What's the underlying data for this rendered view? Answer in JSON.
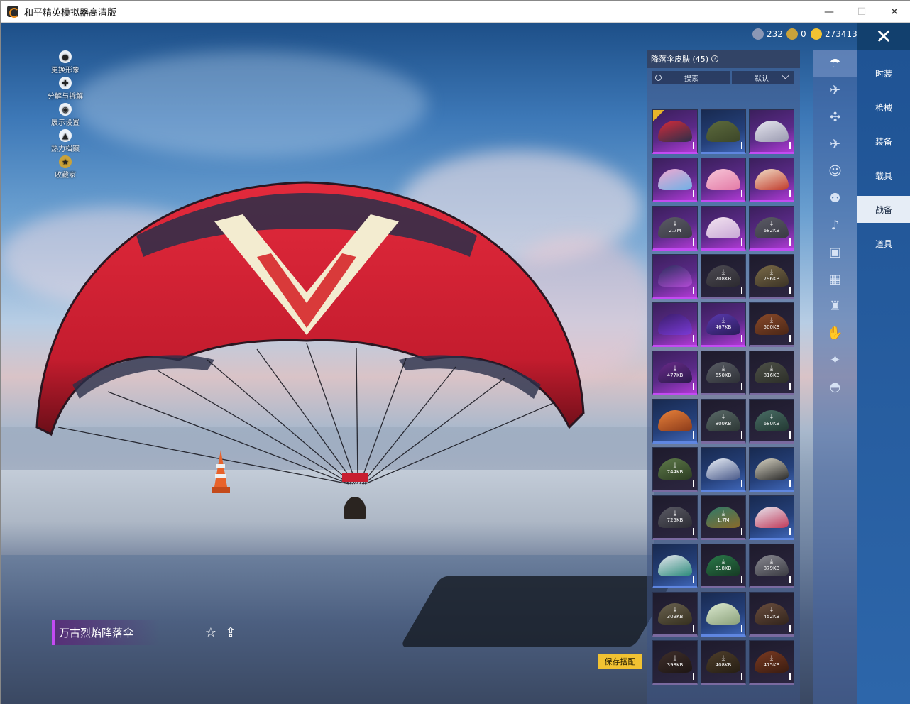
{
  "window": {
    "title": "和平精英模拟器高清版",
    "minimize_glyph": "—",
    "maximize_glyph": "☐",
    "close_glyph": "✕"
  },
  "side_actions": [
    {
      "label": "更换形象",
      "icon": "person-icon",
      "glyph": "●"
    },
    {
      "label": "分解与拆解",
      "icon": "puzzle-icon",
      "glyph": "✚"
    },
    {
      "label": "展示设置",
      "icon": "eye-icon",
      "glyph": "◉"
    },
    {
      "label": "热力档案",
      "icon": "flame-icon",
      "glyph": "▲"
    },
    {
      "label": "收藏家",
      "icon": "collector-badge-icon",
      "glyph": "★"
    }
  ],
  "currency": [
    {
      "value": "232",
      "icon": "coupon-icon",
      "color": "#8a97b5"
    },
    {
      "value": "0",
      "icon": "token-icon",
      "color": "#c9a23a"
    },
    {
      "value": "273413",
      "icon": "gold-coin-icon",
      "color": "#f1c232"
    }
  ],
  "close_button_glyph": "✕",
  "panel": {
    "title": "降落伞皮肤 (45)",
    "help_glyph": "?",
    "search_placeholder": "搜索",
    "sort_label": "默认"
  },
  "items": [
    {
      "rarity": "purple",
      "equipped": true,
      "size": "",
      "colors": [
        "#d62a3a",
        "#2a2f4a"
      ]
    },
    {
      "rarity": "blue",
      "equipped": false,
      "size": "",
      "colors": [
        "#5d6b3d",
        "#3c4628"
      ]
    },
    {
      "rarity": "purple",
      "equipped": false,
      "size": "",
      "colors": [
        "#e6e6ef",
        "#9a9ab0"
      ]
    },
    {
      "rarity": "purple",
      "equipped": false,
      "size": "",
      "colors": [
        "#f0a7d0",
        "#6fb1e6"
      ]
    },
    {
      "rarity": "purple",
      "equipped": false,
      "size": "",
      "colors": [
        "#f7c6d8",
        "#e37aa6"
      ]
    },
    {
      "rarity": "purple",
      "equipped": false,
      "size": "",
      "colors": [
        "#f2e0c8",
        "#c0392b"
      ]
    },
    {
      "rarity": "purple",
      "equipped": false,
      "size": "2.7M",
      "colors": [
        "#5b5b66",
        "#3a3a44"
      ]
    },
    {
      "rarity": "purple",
      "equipped": false,
      "size": "",
      "colors": [
        "#f3e3f0",
        "#c8a8d6"
      ]
    },
    {
      "rarity": "purple",
      "equipped": false,
      "size": "682KB",
      "colors": [
        "#5b5b66",
        "#3a3a44"
      ]
    },
    {
      "rarity": "purple",
      "equipped": false,
      "size": "",
      "colors": [
        "#2a2e5c",
        "#b04ad4"
      ]
    },
    {
      "rarity": "dark",
      "equipped": false,
      "size": "708KB",
      "colors": [
        "#4c4a52",
        "#2c2a30"
      ]
    },
    {
      "rarity": "dark",
      "equipped": false,
      "size": "796KB",
      "colors": [
        "#7a6a48",
        "#3c3426"
      ]
    },
    {
      "rarity": "purple",
      "equipped": false,
      "size": "",
      "colors": [
        "#3a1d6a",
        "#7a3ad6"
      ]
    },
    {
      "rarity": "purple",
      "equipped": false,
      "size": "467KB",
      "colors": [
        "#5a3ab0",
        "#2a1c5a"
      ]
    },
    {
      "rarity": "dark",
      "equipped": false,
      "size": "500KB",
      "colors": [
        "#8a4a2a",
        "#4a2616"
      ]
    },
    {
      "rarity": "purple",
      "equipped": false,
      "size": "477KB",
      "colors": [
        "#6a2a8a",
        "#2a1a4a"
      ]
    },
    {
      "rarity": "dark",
      "equipped": false,
      "size": "650KB",
      "colors": [
        "#5a5e66",
        "#2e3036"
      ]
    },
    {
      "rarity": "dark",
      "equipped": false,
      "size": "816KB",
      "colors": [
        "#4e5148",
        "#2c2e28"
      ]
    },
    {
      "rarity": "blue",
      "equipped": false,
      "size": "",
      "colors": [
        "#e8813a",
        "#8a3a1a"
      ]
    },
    {
      "rarity": "dark",
      "equipped": false,
      "size": "800KB",
      "colors": [
        "#5a6a68",
        "#2c3634"
      ]
    },
    {
      "rarity": "dark",
      "equipped": false,
      "size": "680KB",
      "colors": [
        "#4a6e66",
        "#223832"
      ]
    },
    {
      "rarity": "dark",
      "equipped": false,
      "size": "744KB",
      "colors": [
        "#5e7a4a",
        "#2c3c22"
      ]
    },
    {
      "rarity": "blue",
      "equipped": false,
      "size": "",
      "colors": [
        "#e8eef6",
        "#4a5a8a"
      ]
    },
    {
      "rarity": "blue",
      "equipped": false,
      "size": "",
      "colors": [
        "#d8d4c4",
        "#2a2a2a"
      ]
    },
    {
      "rarity": "dark",
      "equipped": false,
      "size": "725KB",
      "colors": [
        "#5a5a64",
        "#2c2c34"
      ]
    },
    {
      "rarity": "dark",
      "equipped": false,
      "size": "1.7M",
      "colors": [
        "#2e7a6a",
        "#8a6a2a"
      ]
    },
    {
      "rarity": "blue",
      "equipped": false,
      "size": "",
      "colors": [
        "#e8e8f0",
        "#c03a5a"
      ]
    },
    {
      "rarity": "blue",
      "equipped": false,
      "size": "",
      "colors": [
        "#e8e8f0",
        "#2a8a7a"
      ]
    },
    {
      "rarity": "dark",
      "equipped": false,
      "size": "618KB",
      "colors": [
        "#2a7a4a",
        "#163a24"
      ]
    },
    {
      "rarity": "dark",
      "equipped": false,
      "size": "879KB",
      "colors": [
        "#8a8a92",
        "#3a3a42"
      ]
    },
    {
      "rarity": "dark",
      "equipped": false,
      "size": "309KB",
      "colors": [
        "#6a6250",
        "#36301f"
      ]
    },
    {
      "rarity": "blue",
      "equipped": false,
      "size": "",
      "colors": [
        "#dcead0",
        "#8aa07a"
      ]
    },
    {
      "rarity": "dark",
      "equipped": false,
      "size": "452KB",
      "colors": [
        "#6a4e3e",
        "#32241c"
      ]
    },
    {
      "rarity": "dark",
      "equipped": false,
      "size": "398KB",
      "colors": [
        "#3e2e2a",
        "#1e1614"
      ]
    },
    {
      "rarity": "dark",
      "equipped": false,
      "size": "408KB",
      "colors": [
        "#4e3e2a",
        "#261e14"
      ]
    },
    {
      "rarity": "dark",
      "equipped": false,
      "size": "475KB",
      "colors": [
        "#7a3a22",
        "#3a1c10"
      ]
    }
  ],
  "icon_strip": [
    {
      "icon": "parachute-icon",
      "glyph": "☂",
      "active": true
    },
    {
      "icon": "glider-icon",
      "glyph": "✈",
      "active": false
    },
    {
      "icon": "drone-icon",
      "glyph": "✣",
      "active": false
    },
    {
      "icon": "plane-icon",
      "glyph": "✈",
      "active": false
    },
    {
      "icon": "emote-face-icon",
      "glyph": "☺",
      "active": false
    },
    {
      "icon": "robot-icon",
      "glyph": "⚉",
      "active": false
    },
    {
      "icon": "speaker-icon",
      "glyph": "♪",
      "active": false
    },
    {
      "icon": "sticker-icon",
      "glyph": "▣",
      "active": false
    },
    {
      "icon": "image-frame-icon",
      "glyph": "▦",
      "active": false
    },
    {
      "icon": "fire-extinguisher-icon",
      "glyph": "♜",
      "active": false
    },
    {
      "icon": "hand-gesture-icon",
      "glyph": "✋",
      "active": false
    },
    {
      "icon": "magic-wand-icon",
      "glyph": "✦",
      "active": false
    },
    {
      "icon": "ufo-icon",
      "glyph": "◓",
      "active": false
    }
  ],
  "tabs": [
    {
      "label": "时装",
      "active": false
    },
    {
      "label": "枪械",
      "active": false
    },
    {
      "label": "装备",
      "active": false
    },
    {
      "label": "载具",
      "active": false
    },
    {
      "label": "战备",
      "active": true
    },
    {
      "label": "道具",
      "active": false
    }
  ],
  "selected_item_name": "万古烈焰降落伞",
  "favorite_glyph": "☆",
  "share_glyph": "⇪",
  "save_button": "保存搭配",
  "colors": {
    "accent_purple": "#c34bf2",
    "save_yellow": "#f1c232",
    "tab_blue": "#1f5394"
  }
}
